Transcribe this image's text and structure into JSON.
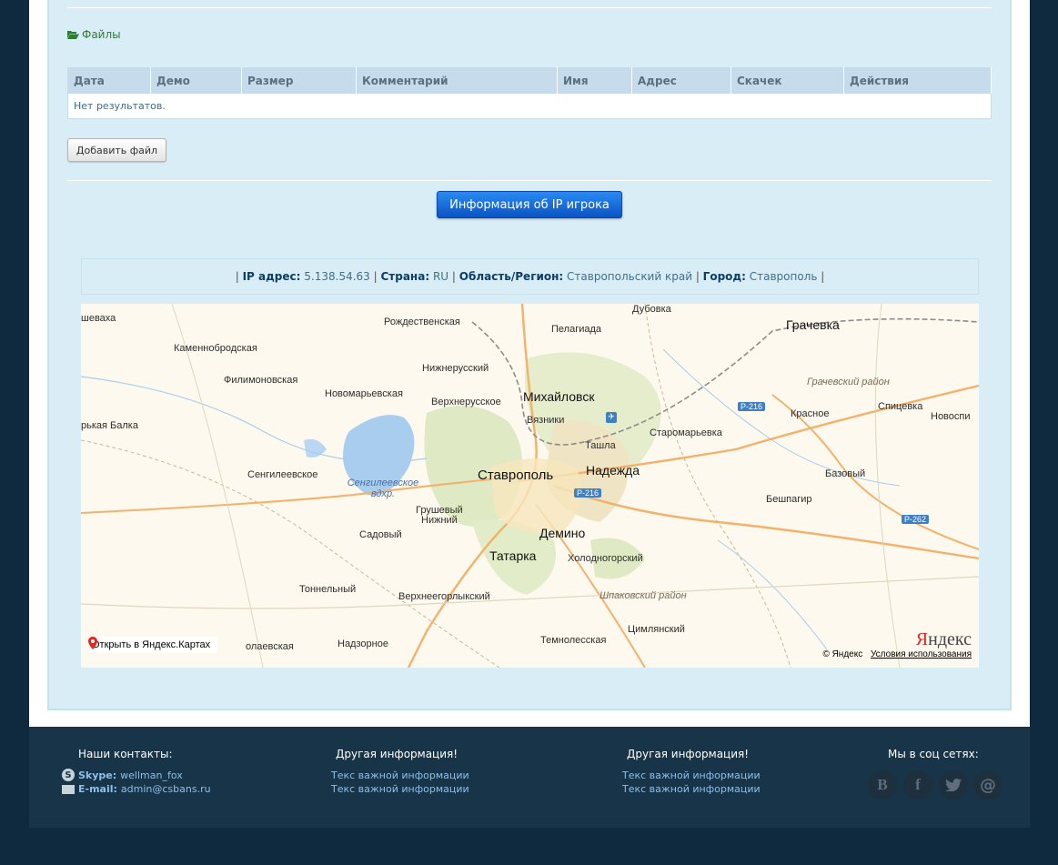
{
  "files": {
    "link_label": "Файлы",
    "columns": [
      "Дата",
      "Демо",
      "Размер",
      "Комментарий",
      "Имя",
      "Адрес",
      "Скачек",
      "Действия"
    ],
    "empty_text": "Нет результатов.",
    "add_button": "Добавить файл"
  },
  "ip_button": "Информация об IP игрока",
  "ip_info": {
    "ip_label": "IP адрес:",
    "ip_value": "5.138.54.63",
    "country_label": "Страна:",
    "country_value": "RU",
    "region_label": "Область/Регион:",
    "region_value": "Ставропольский край",
    "city_label": "Город:",
    "city_value": "Ставрополь"
  },
  "map": {
    "labels": {
      "l01": "шеваха",
      "l02": "Рождественская",
      "l03": "Пелагиада",
      "l04": "Дубовка",
      "l05": "Грачевка",
      "l06": "Каменнобродская",
      "l07": "Нижнерусский",
      "l08": "Филимоновская",
      "l09": "Новомарьевская",
      "l10": "Верхнерусское",
      "l11": "Михайловск",
      "l12": "Грачевский район",
      "l13": "Вязники",
      "l14": "Красное",
      "l15": "Спицевка",
      "l16": "Новоспи",
      "l17": "рькая Балка",
      "l18": "Старомарьевка",
      "l19": "Ташла",
      "l20": "Сенгилеевское",
      "l21": "Ставрополь",
      "l22": "Надежда",
      "l23": "Базовый",
      "l24": "Грушевый",
      "l25": "Нижний",
      "l26": "Бешпагир",
      "l27": "Садовый",
      "l28": "Демино",
      "l29": "Татарка",
      "l30": "Холодногорский",
      "l31": "Тоннельный",
      "l32": "Верхнеегорлыкский",
      "l33": "Шпаковский район",
      "l34": "Цимлянский",
      "l35": "олаевская",
      "l36": "Надзорное",
      "l37": "Темнолесская",
      "lake": "Сенгилеевское вдхр."
    },
    "roads": [
      "Р-216",
      "Р-216",
      "Р-262"
    ],
    "open_label": "Открыть в Яндекс.Картах",
    "logo": "Яндекс",
    "copyright": "© Яндекс",
    "terms": "Условия использования"
  },
  "footer": {
    "contacts_title": "Наши контакты:",
    "skype_label": "Skype:",
    "skype_value": "wellman_fox",
    "email_label": "E-mail:",
    "email_value": "admin@csbans.ru",
    "info_title_1": "Другая информация!",
    "info_title_2": "Другая информация!",
    "info_links_1": [
      "Текс важной информации",
      "Текс важной информации"
    ],
    "info_links_2": [
      "Текс важной информации",
      "Текс важной информации"
    ],
    "social_title": "Мы в соц сетях:",
    "social": [
      "vk-icon",
      "facebook-icon",
      "twitter-icon",
      "mail-icon"
    ]
  },
  "colors": {
    "accent": "#1565c0",
    "panel": "#d9edf7",
    "footer": "#173449",
    "background": "#0f2a3e"
  }
}
